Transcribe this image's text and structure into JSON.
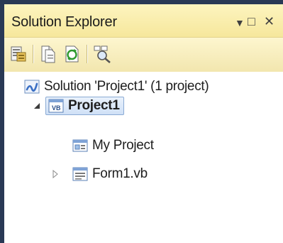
{
  "window": {
    "title": "Solution Explorer",
    "controls": {
      "pin": "▼",
      "maximize": "□",
      "close": "✕"
    }
  },
  "toolbar": {
    "buttons": [
      {
        "icon": "properties-icon"
      },
      {
        "icon": "show-all-files-icon"
      },
      {
        "icon": "refresh-icon"
      },
      {
        "icon": "view-class-diagram-icon"
      }
    ]
  },
  "tree": {
    "solution": {
      "label": "Solution 'Project1' (1 project)",
      "icon": "solution-icon"
    },
    "project": {
      "label": "Project1",
      "icon": "vb-project-icon",
      "expanded": true,
      "selected": true,
      "children": [
        {
          "label": "My Project",
          "icon": "my-project-icon",
          "expandable": false
        },
        {
          "label": "Form1.vb",
          "icon": "form-icon",
          "expandable": true,
          "expanded": false
        }
      ]
    }
  },
  "colors": {
    "frame": "#293955",
    "titlebar": "#f6e79c",
    "selection_border": "#8aaad4",
    "selection_fill": "#cfe0f6"
  }
}
